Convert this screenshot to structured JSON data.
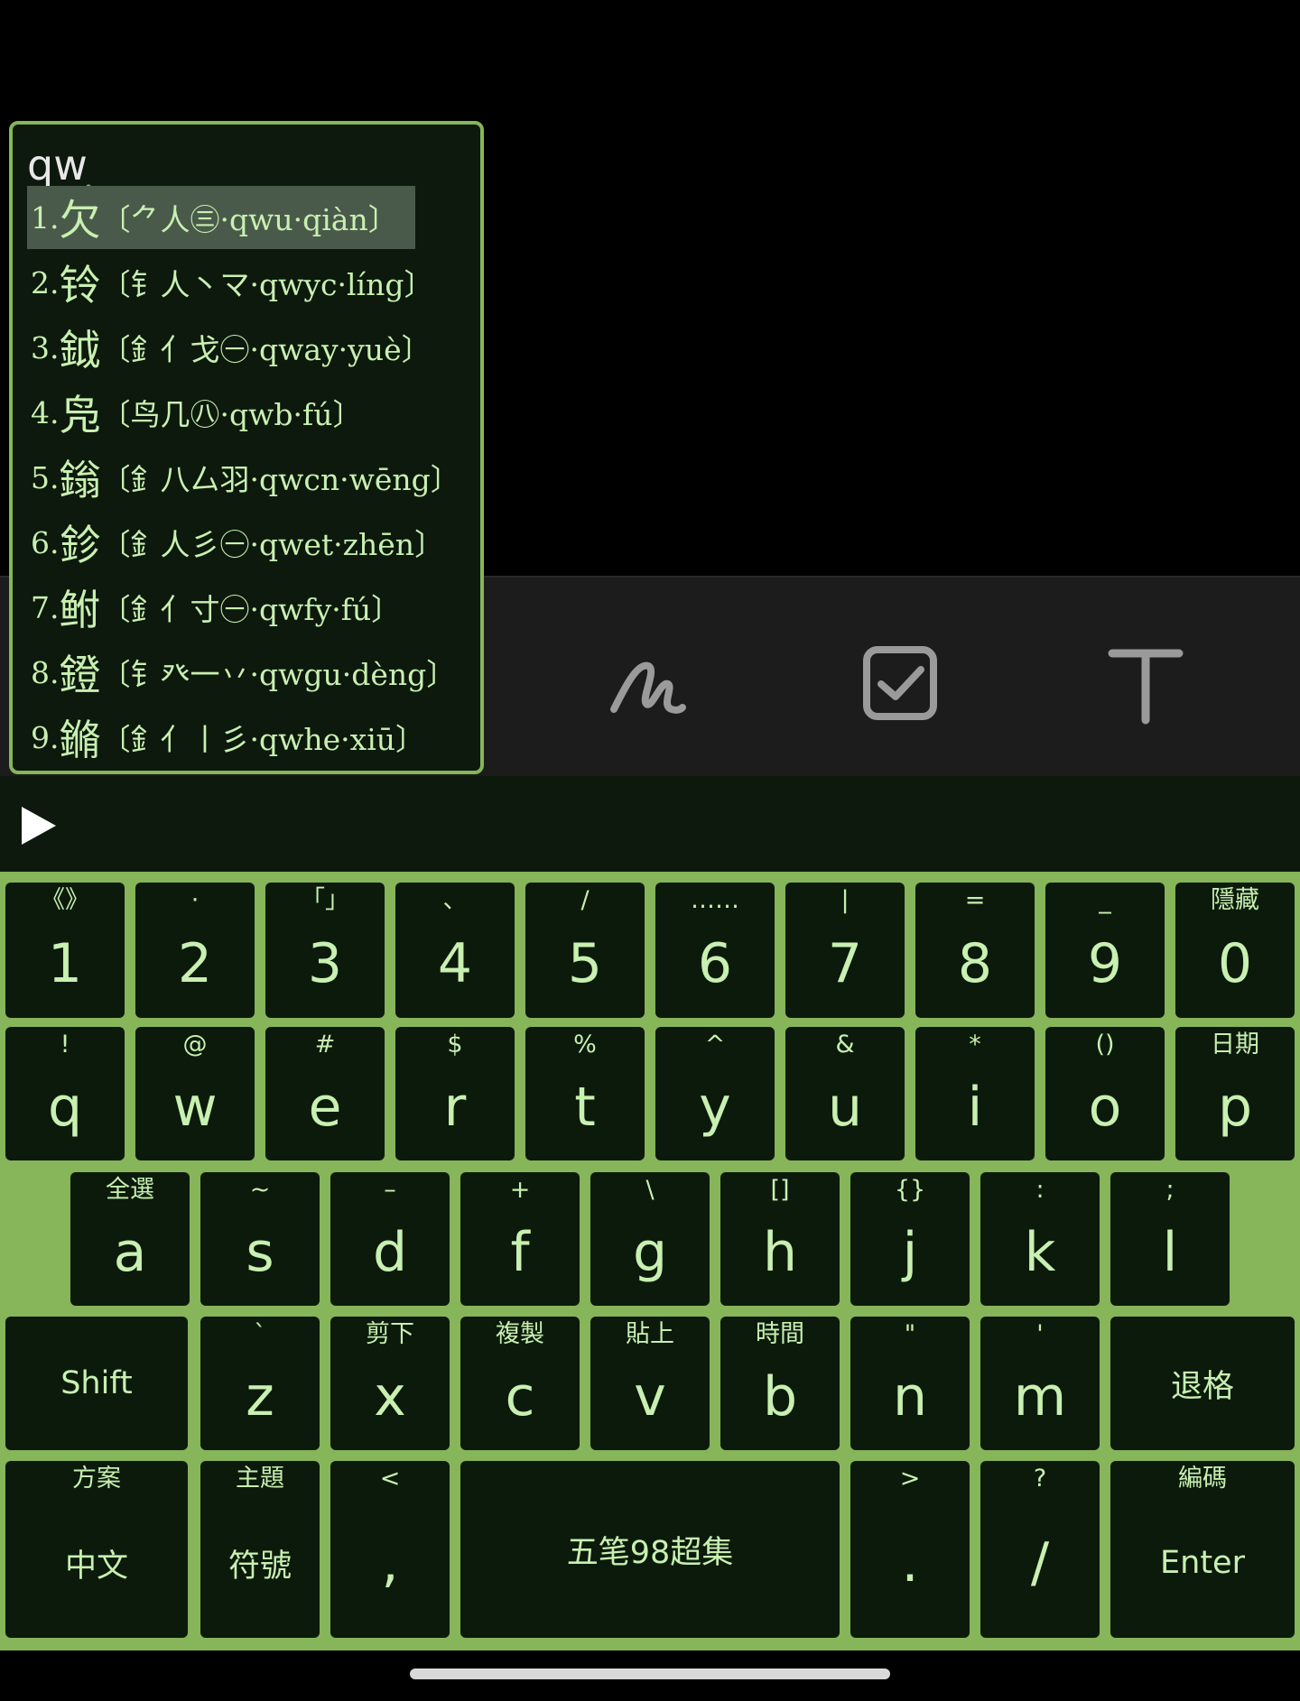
{
  "candidate_popup": {
    "input_code": "qw",
    "caret": "^",
    "candidates": [
      {
        "index": "1.",
        "char": "欠",
        "detail": "〔⺈人㊂·qwu·qiàn〕",
        "selected": true
      },
      {
        "index": "2.",
        "char": "铃",
        "detail": "〔钅人丶マ·qwyc·líng〕",
        "selected": false
      },
      {
        "index": "3.",
        "char": "鉞",
        "detail": "〔釒亻戈㊀·qway·yuè〕",
        "selected": false
      },
      {
        "index": "4.",
        "char": "凫",
        "detail": "〔鸟几㊇·qwb·fú〕",
        "selected": false
      },
      {
        "index": "5.",
        "char": "鎓",
        "detail": "〔釒八厶羽·qwcn·wēng〕",
        "selected": false
      },
      {
        "index": "6.",
        "char": "鉁",
        "detail": "〔釒人彡㊀·qwet·zhēn〕",
        "selected": false
      },
      {
        "index": "7.",
        "char": "鲋",
        "detail": "〔釒亻寸㊀·qwfy·fú〕",
        "selected": false
      },
      {
        "index": "8.",
        "char": "鐙",
        "detail": "〔钅癶一丷·qwgu·dèng〕",
        "selected": false
      },
      {
        "index": "9.",
        "char": "鏅",
        "detail": "〔釒亻丨彡·qwhe·xiū〕",
        "selected": false
      }
    ]
  },
  "toolbar": {
    "icons": [
      "voice-icon",
      "image-icon",
      "handwriting-icon",
      "checkbox-icon",
      "text-format-icon"
    ]
  },
  "compose_bar": {
    "play_icon": "play-triangle-icon"
  },
  "keyboard": {
    "row1": [
      {
        "hint": "《》",
        "main": "1"
      },
      {
        "hint": "·",
        "main": "2"
      },
      {
        "hint": "「」",
        "main": "3"
      },
      {
        "hint": "、",
        "main": "4"
      },
      {
        "hint": "/",
        "main": "5"
      },
      {
        "hint": "……",
        "main": "6"
      },
      {
        "hint": "|",
        "main": "7"
      },
      {
        "hint": "=",
        "main": "8"
      },
      {
        "hint": "_",
        "main": "9"
      },
      {
        "hint": "隱藏",
        "main": "0"
      }
    ],
    "row2": [
      {
        "hint": "!",
        "main": "q"
      },
      {
        "hint": "@",
        "main": "w"
      },
      {
        "hint": "#",
        "main": "e"
      },
      {
        "hint": "$",
        "main": "r"
      },
      {
        "hint": "%",
        "main": "t"
      },
      {
        "hint": "^",
        "main": "y"
      },
      {
        "hint": "&",
        "main": "u"
      },
      {
        "hint": "*",
        "main": "i"
      },
      {
        "hint": "()",
        "main": "o"
      },
      {
        "hint": "日期",
        "main": "p"
      }
    ],
    "row3": [
      {
        "hint": "全選",
        "main": "a"
      },
      {
        "hint": "~",
        "main": "s"
      },
      {
        "hint": "–",
        "main": "d"
      },
      {
        "hint": "+",
        "main": "f"
      },
      {
        "hint": "\\",
        "main": "g"
      },
      {
        "hint": "[]",
        "main": "h"
      },
      {
        "hint": "{}",
        "main": "j"
      },
      {
        "hint": ":",
        "main": "k"
      },
      {
        "hint": ";",
        "main": "l"
      }
    ],
    "row4": [
      {
        "hint": "",
        "main": "Shift"
      },
      {
        "hint": "`",
        "main": "z"
      },
      {
        "hint": "剪下",
        "main": "x"
      },
      {
        "hint": "複製",
        "main": "c"
      },
      {
        "hint": "貼上",
        "main": "v"
      },
      {
        "hint": "時間",
        "main": "b"
      },
      {
        "hint": "\"",
        "main": "n"
      },
      {
        "hint": "'",
        "main": "m"
      },
      {
        "hint": "",
        "main": "退格"
      }
    ],
    "row5": [
      {
        "hint": "方案",
        "main": "中文"
      },
      {
        "hint": "主題",
        "main": "符號"
      },
      {
        "hint": "<",
        "main": ","
      },
      {
        "hint": "",
        "main": "五笔98超集"
      },
      {
        "hint": ">",
        "main": "."
      },
      {
        "hint": "?",
        "main": "/"
      },
      {
        "hint": "編碼",
        "main": "Enter"
      }
    ]
  },
  "colors": {
    "keyboard_bg": "#86b55a",
    "key_bg": "#0c1a0c",
    "key_text": "#c8f0b0",
    "selected_candidate_bg": "#4a5a4a"
  }
}
